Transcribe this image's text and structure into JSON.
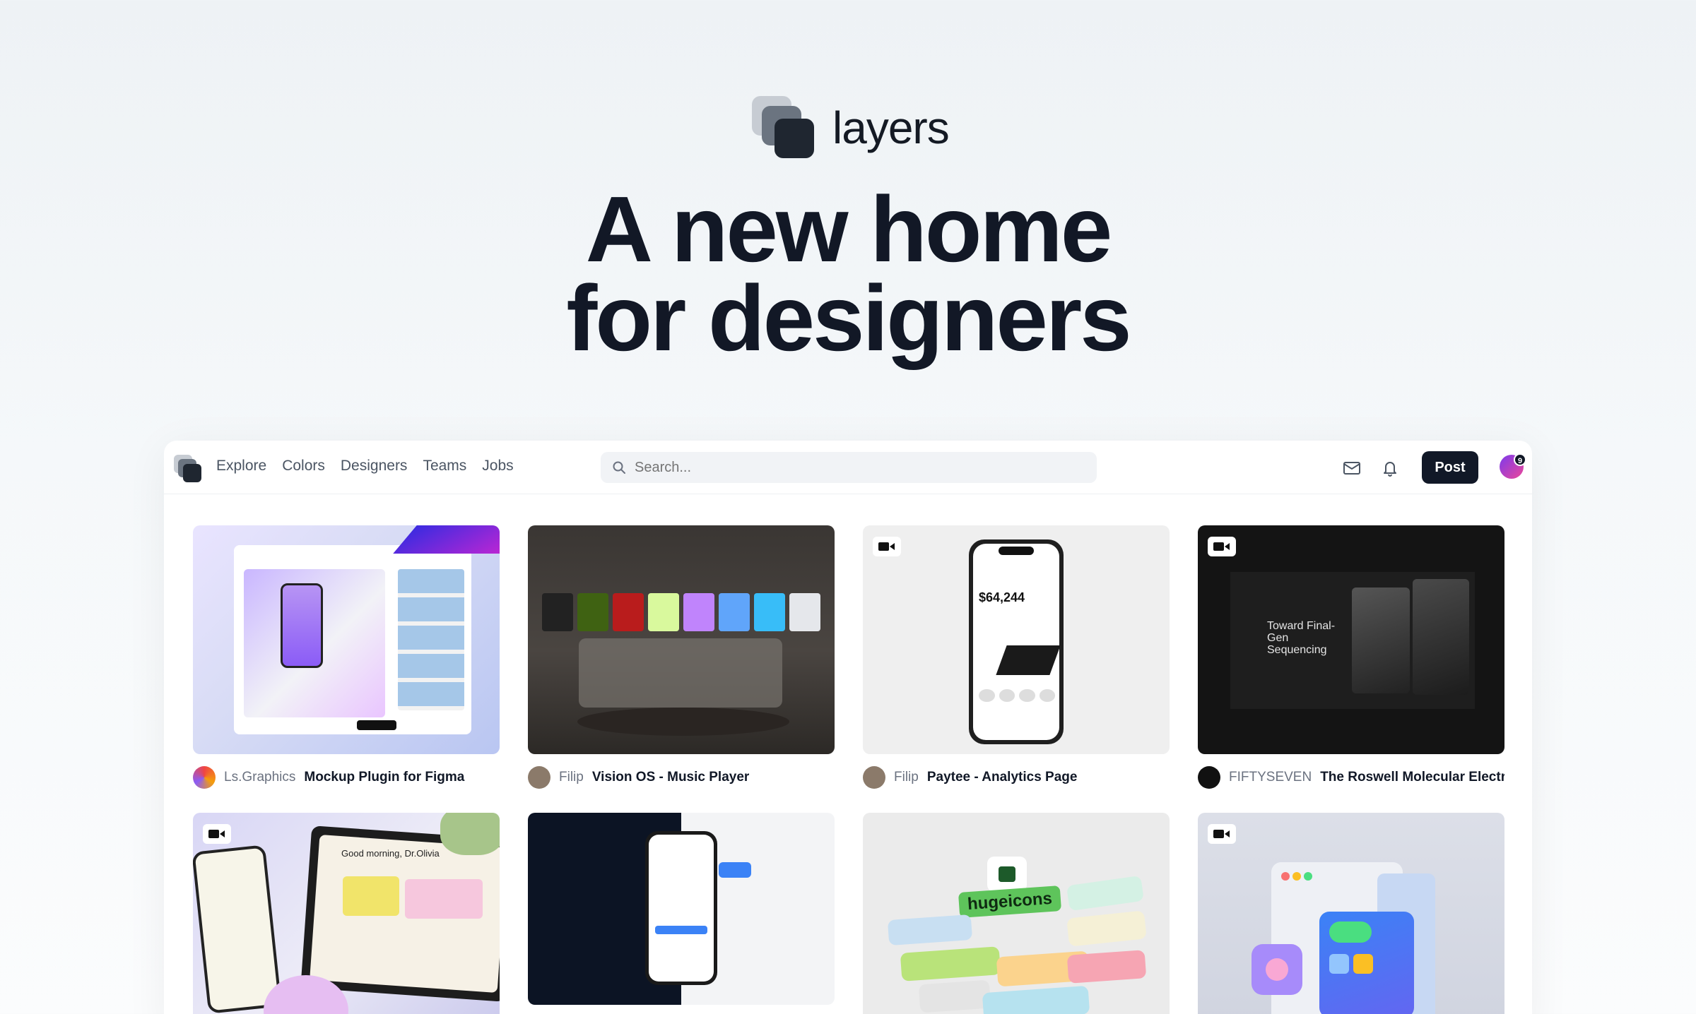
{
  "brand": {
    "name": "layers"
  },
  "hero": {
    "line1": "A new home",
    "line2": "for designers"
  },
  "nav": {
    "items": [
      "Explore",
      "Colors",
      "Designers",
      "Teams",
      "Jobs"
    ]
  },
  "search": {
    "placeholder": "Search..."
  },
  "actions": {
    "post_label": "Post",
    "notification_count": "9"
  },
  "shots": [
    {
      "creator": "Ls.Graphics",
      "title": "Mockup Plugin for Figma",
      "has_video": false
    },
    {
      "creator": "Filip",
      "title": "Vision OS - Music Player",
      "has_video": false
    },
    {
      "creator": "Filip",
      "title": "Paytee - Analytics Page",
      "has_video": true,
      "amount": "$64,244"
    },
    {
      "creator": "FIFTYSEVEN",
      "title": "The Roswell Molecular Electr",
      "has_video": true,
      "headline": "Toward Final-Gen Sequencing"
    },
    {
      "has_video": true,
      "greeting": "Good morning, Dr.Olivia"
    },
    {
      "has_video": false
    },
    {
      "has_video": false,
      "label": "hugeicons"
    },
    {
      "has_video": true
    }
  ],
  "colors": {
    "accent": "#111827",
    "text": "#121826",
    "muted": "#6b7280"
  }
}
